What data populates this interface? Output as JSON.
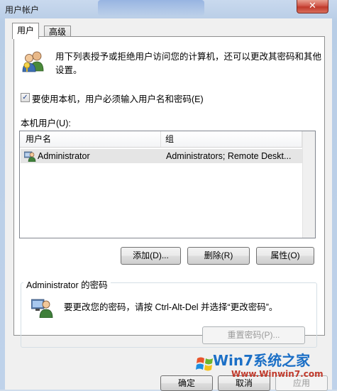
{
  "window": {
    "title": "用户帐户",
    "close_glyph": "✕"
  },
  "tabs": [
    {
      "label": "用户"
    },
    {
      "label": "高级"
    }
  ],
  "intro_text_line1": "用下列表授予或拒绝用户访问您的计算机，还可以更改其密码和其他",
  "intro_text_line2": "设置。",
  "require_login": {
    "label": "要使用本机，用户必须输入用户名和密码(E)",
    "checked": true,
    "check_glyph": "✓"
  },
  "local_users_label": "本机用户(U):",
  "users_table": {
    "columns": [
      "用户名",
      "组"
    ],
    "rows": [
      {
        "name": "Administrator",
        "group": "Administrators; Remote Deskt..."
      }
    ]
  },
  "buttons": {
    "add": "添加(D)...",
    "remove": "删除(R)",
    "properties": "属性(O)"
  },
  "password_group": {
    "title": "Administrator 的密码",
    "message": "要更改您的密码，请按 Ctrl-Alt-Del 并选择“更改密码”。",
    "reset_button": "重置密码(P)..."
  },
  "footer": {
    "ok": "确定",
    "cancel": "取消",
    "apply": "应用"
  },
  "watermark": {
    "brand": "Win7系统之家",
    "url": "Www.Winwin7.com"
  }
}
